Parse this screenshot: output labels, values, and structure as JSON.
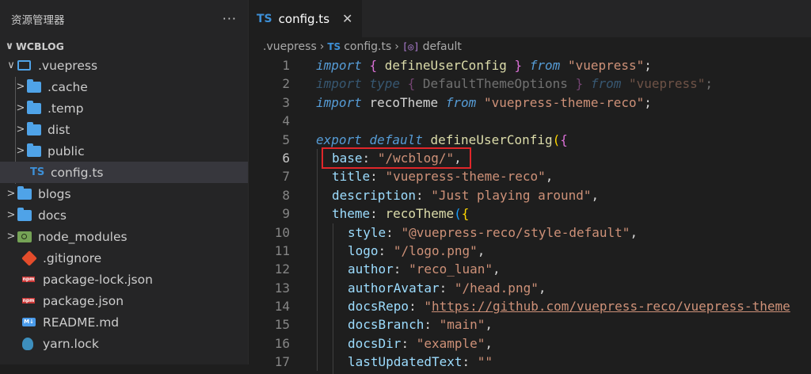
{
  "explorer": {
    "title": "资源管理器",
    "more": "···",
    "root": "WCBLOG",
    "items": [
      {
        "label": ".vuepress",
        "chev": "∨"
      },
      {
        "label": ".cache",
        "chev": ">"
      },
      {
        "label": ".temp",
        "chev": ">"
      },
      {
        "label": "dist",
        "chev": ">"
      },
      {
        "label": "public",
        "chev": ">"
      },
      {
        "label": "config.ts",
        "icon": "TS"
      },
      {
        "label": "blogs",
        "chev": ">"
      },
      {
        "label": "docs",
        "chev": ">"
      },
      {
        "label": "node_modules",
        "chev": ">"
      },
      {
        "label": ".gitignore"
      },
      {
        "label": "package-lock.json",
        "icon": "npm"
      },
      {
        "label": "package.json",
        "icon": "npm"
      },
      {
        "label": "README.md",
        "icon": "M↓"
      },
      {
        "label": "yarn.lock"
      }
    ],
    "root_chev": "∨"
  },
  "tab": {
    "icon": "TS",
    "label": "config.ts",
    "close": "✕"
  },
  "breadcrumb": {
    "part1": ".vuepress",
    "sep": "›",
    "icon": "TS",
    "part2": "config.ts",
    "sym_icon": "[◎]",
    "part3": "default"
  },
  "code": {
    "line_numbers": [
      "1",
      "2",
      "3",
      "4",
      "5",
      "6",
      "7",
      "8",
      "9",
      "10",
      "11",
      "12",
      "13",
      "14",
      "15",
      "16",
      "17"
    ],
    "l1": {
      "kw": "import",
      "b1": "{",
      "fn": "defineUserConfig",
      "b2": "}",
      "from": "from",
      "str": "\"vuepress\"",
      "end": ";"
    },
    "l2": {
      "kw": "import",
      "kw2": "type",
      "b1": "{",
      "fn": "DefaultThemeOptions",
      "b2": "}",
      "from": "from",
      "str": "\"vuepress\"",
      "end": ";"
    },
    "l3": {
      "kw": "import",
      "name": "recoTheme",
      "from": "from",
      "str": "\"vuepress-theme-reco\"",
      "end": ";"
    },
    "l5": {
      "kw": "export",
      "kw2": "default",
      "fn": "defineUserConfig",
      "p": "(",
      "b": "{"
    },
    "l6": {
      "key": "base",
      "colon": ":",
      "str": "\"/wcblog/\"",
      "end": ","
    },
    "l7": {
      "key": "title",
      "colon": ":",
      "str": "\"vuepress-theme-reco\"",
      "end": ","
    },
    "l8": {
      "key": "description",
      "colon": ":",
      "str": "\"Just playing around\"",
      "end": ","
    },
    "l9": {
      "key": "theme",
      "colon": ":",
      "fn": "recoTheme",
      "p": "(",
      "b": "{"
    },
    "l10": {
      "key": "style",
      "colon": ":",
      "str": "\"@vuepress-reco/style-default\"",
      "end": ","
    },
    "l11": {
      "key": "logo",
      "colon": ":",
      "str": "\"/logo.png\"",
      "end": ","
    },
    "l12": {
      "key": "author",
      "colon": ":",
      "str": "\"reco_luan\"",
      "end": ","
    },
    "l13": {
      "key": "authorAvatar",
      "colon": ":",
      "str": "\"/head.png\"",
      "end": ","
    },
    "l14": {
      "key": "docsRepo",
      "colon": ":",
      "q": "\"",
      "url": "https://github.com/vuepress-reco/vuepress-theme"
    },
    "l15": {
      "key": "docsBranch",
      "colon": ":",
      "str": "\"main\"",
      "end": ","
    },
    "l16": {
      "key": "docsDir",
      "colon": ":",
      "str": "\"example\"",
      "end": ","
    },
    "l17": {
      "key": "lastUpdatedText",
      "colon": ":",
      "str": "\"\""
    }
  },
  "colors": {
    "keyword": "#569cd6",
    "string": "#ce9178",
    "function": "#dcdcaa",
    "property": "#9cdcfe",
    "highlight_box": "#e0262a"
  }
}
